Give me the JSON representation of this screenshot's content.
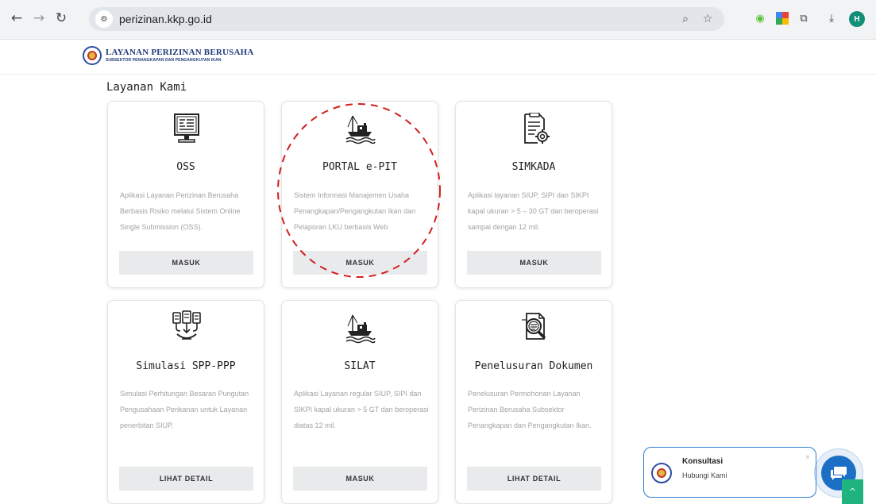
{
  "browser": {
    "url": "perizinan.kkp.go.id",
    "profile_initial": "H",
    "icons": [
      "back-arrow-icon",
      "forward-arrow-icon",
      "reload-icon",
      "site-settings-icon",
      "zoom-icon",
      "bookmark-star-icon",
      "extension-icon",
      "google-icon",
      "puzzle-extensions-icon",
      "download-icon"
    ]
  },
  "header": {
    "logo_title": "LAYANAN PERIZINAN BERUSAHA",
    "logo_subtitle": "SUBSEKTOR PENANGKAPAN DAN PENGANGKUTAN IKAN"
  },
  "main": {
    "section_title": "Layanan Kami",
    "cards": [
      {
        "title": "OSS",
        "icon": "computer-monitor-icon",
        "desc": "Aplikasi Layanan Perizinan Berusaha Berbasis Risiko melalui Sistem Online Single Submission (OSS).",
        "button": "MASUK"
      },
      {
        "title": "PORTAL e-PIT",
        "icon": "fishing-boat-icon",
        "desc": "Sistem Informasi Manajemen Usaha Penangkapan/Pengangkutan Ikan dan Pelaporan LKU berbasis Web",
        "button": "MASUK"
      },
      {
        "title": "SIMKADA",
        "icon": "document-gear-icon",
        "desc": "Aplikasi layanan SIUP, SIPI dan SIKPI kapal ukuran > 5 – 30 GT dan beroperasi sampai dengan 12 mil.",
        "button": "MASUK"
      },
      {
        "title": "Simulasi SPP-PPP",
        "icon": "calculation-flow-icon",
        "desc": "Simulasi Perhitungan Besaran Pungutan Pengusahaan Perikanan untuk Layanan penerbitan SIUP.",
        "button": "LIHAT DETAIL"
      },
      {
        "title": "SILAT",
        "icon": "fishing-boat-icon",
        "desc": "Aplikasi Layanan regular SIUP, SIPI dan SIKPI kapal ukuran > 5 GT dan beroperasi diatas 12 mil.",
        "button": "MASUK"
      },
      {
        "title": "Penelusuran Dokumen",
        "icon": "document-search-icon",
        "desc": "Penelusuran Permohonan Layanan Perizinan Berusaha Subsektor Penangkapan dan Pengangkutan Ikan.",
        "button": "LIHAT DETAIL"
      }
    ]
  },
  "widget": {
    "title": "Konsultasi",
    "subtitle": "Hubungi Kami",
    "close": "×",
    "scroll_top": "^"
  }
}
